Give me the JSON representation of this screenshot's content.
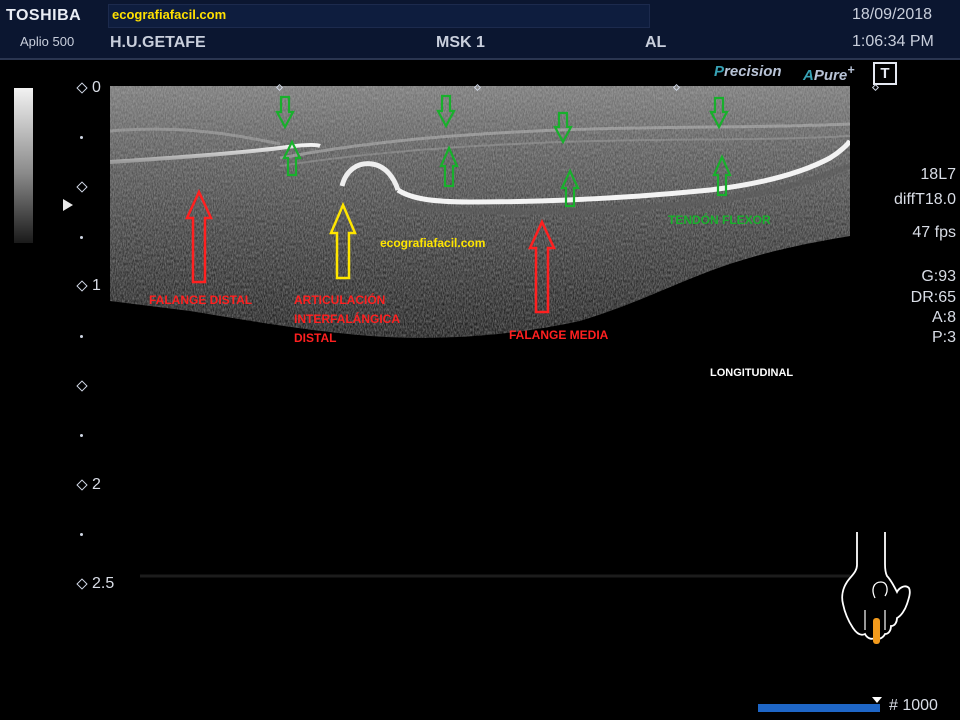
{
  "header": {
    "brand": "TOSHIBA",
    "model": "Aplio 500",
    "watermark": "ecografiafacil.com",
    "hospital": "H.U.GETAFE",
    "preset": "MSK 1",
    "operator": "AL",
    "date": "18/09/2018",
    "time": "1:06:34 PM"
  },
  "logos": {
    "precision_p": "P",
    "precision_rest": "recision",
    "apure_a": "A",
    "apure_rest": "Pure",
    "apure_plus": "+",
    "t_box": "T"
  },
  "depth_scale": [
    "0",
    "1",
    "2",
    "2.5"
  ],
  "side_panel": {
    "probe": "18L7",
    "mode": "diffT18.0",
    "fps": "47 fps",
    "gain": "G:93",
    "dynamic_range": "DR:65",
    "a": "A:8",
    "p": "P:3"
  },
  "annotations": {
    "falange_distal": "FALANGE DISTAL",
    "articulacion_1": "ARTICULACIÓN",
    "articulacion_2": "INTERFALÁNGICA",
    "articulacion_3": "DISTAL",
    "falange_media": "FALANGE MEDIA",
    "tendon_flexor": "TENDÓN FLEXOR",
    "watermark_image": "ecografiafacil.com",
    "view": "LONGITUDINAL"
  },
  "colors": {
    "red_arrow": "#ff2020",
    "yellow_arrow": "#ffe600",
    "green_arrow": "#18b02c",
    "frame_bar": "#1e66c6",
    "finger_marker": "#f29a1c"
  },
  "footer": {
    "frame_count": "# 1000"
  }
}
